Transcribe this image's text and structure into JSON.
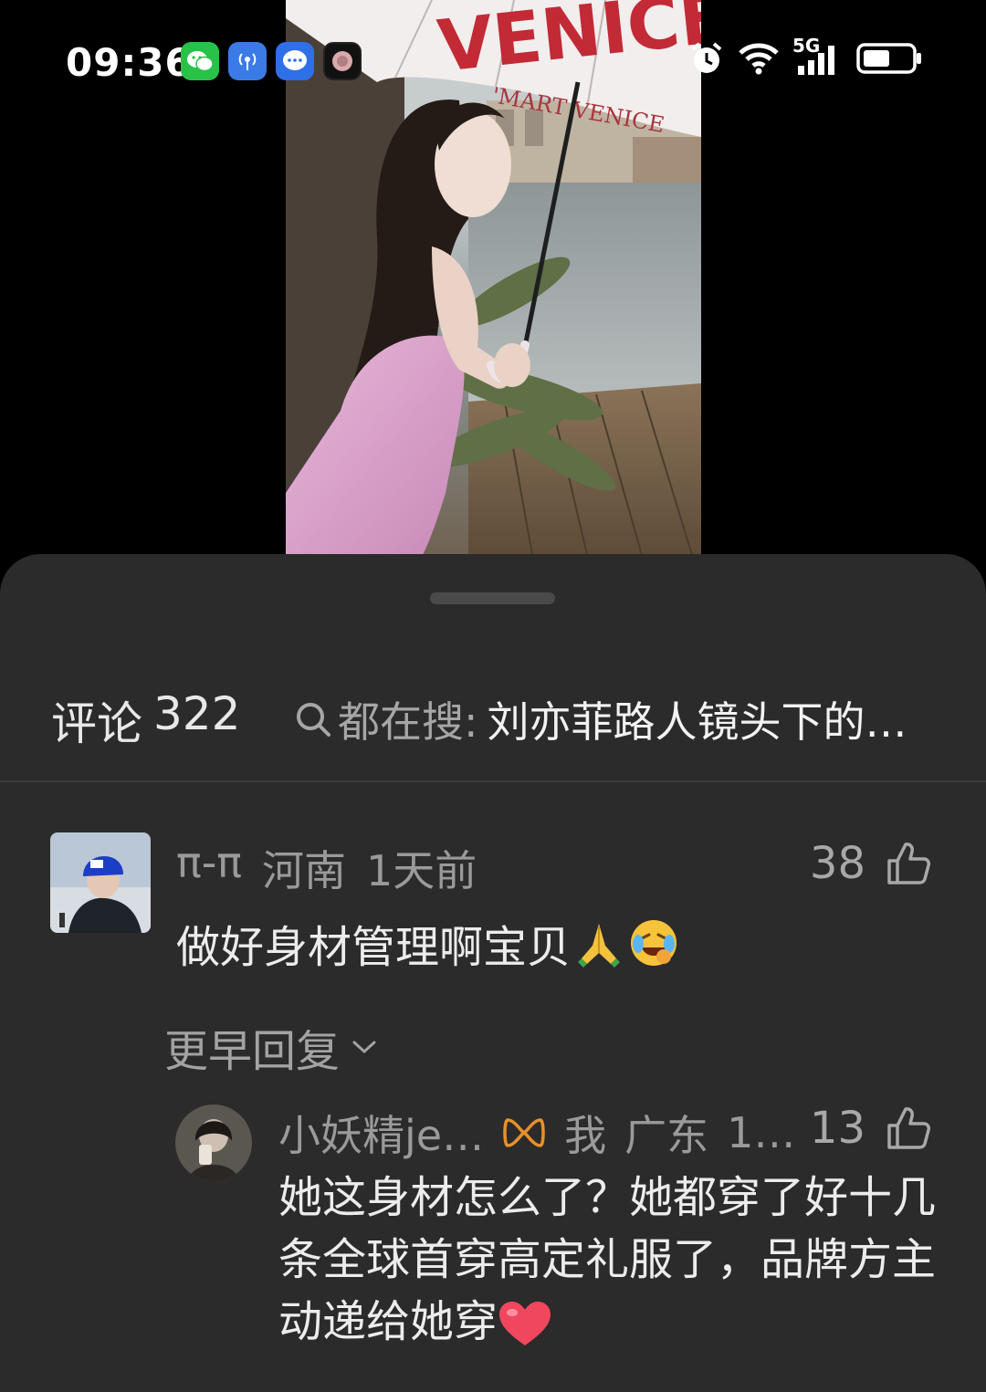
{
  "status_bar": {
    "time": "09:36",
    "notification_icons": [
      "wechat-icon",
      "signal-app-icon",
      "message-icon",
      "camera-app-icon"
    ],
    "network_label": "5G",
    "system_icons": [
      "alarm-icon",
      "wifi-icon",
      "cellular-signal-icon",
      "battery-icon"
    ]
  },
  "photo": {
    "umbrella_text": "VENICE",
    "umbrella_small_text": "'MART VENICE"
  },
  "comments_panel": {
    "title_label": "评论",
    "count": "322",
    "search_label": "都在搜:",
    "search_query": "刘亦菲路人镜头下的…"
  },
  "comments": [
    {
      "username": "π-π",
      "location": "河南",
      "time": "1天前",
      "likes": "38",
      "text": "做好身材管理啊宝贝"
    }
  ],
  "earlier_replies_label": "更早回复",
  "reply": {
    "username": "小妖精je…",
    "self_label": "我",
    "location": "广东",
    "time": "1…",
    "likes": "13",
    "text": "她这身材怎么了？她都穿了好十几条全球首穿高定礼服了，品牌方主动递给她穿"
  },
  "colors": {
    "sheet_bg": "#2b2b2b",
    "badge_orange": "#e8902a",
    "heart": "#f0475e"
  }
}
